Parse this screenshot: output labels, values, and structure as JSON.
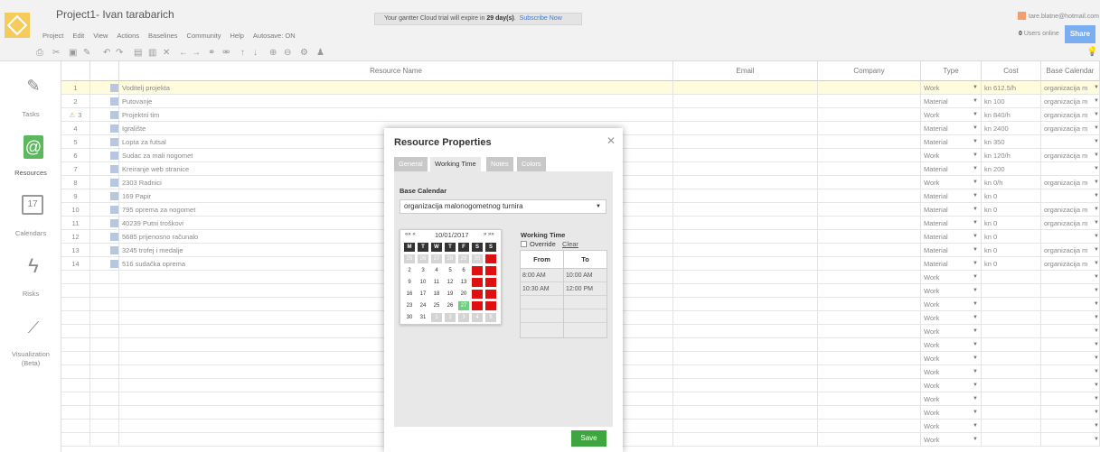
{
  "header": {
    "project_title": "Project1- Ivan tarabarich",
    "menu": [
      "Project",
      "Edit",
      "View",
      "Actions",
      "Baselines",
      "Community",
      "Help",
      "Autosave: ON"
    ],
    "trial_prefix": "Your gantter Cloud trial will expire in ",
    "trial_days": "29 day(s)",
    "trial_dot": ".",
    "subscribe": "Subscribe Now",
    "user_email": "tare.blatne@hotmail.com",
    "users_online_count": "0",
    "users_online_label": "Users online",
    "share": "Share"
  },
  "toolbar": {
    "icons": [
      "print-icon",
      "cut-icon",
      "copy-icon",
      "paste-icon",
      "undo-icon",
      "redo-icon",
      "insert-row-icon",
      "insert-column-icon",
      "delete-icon",
      "outdent-icon",
      "indent-icon",
      "link-icon",
      "unlink-icon",
      "move-up-icon",
      "move-down-icon",
      "zoom-in-icon",
      "zoom-out-icon",
      "settings-icon",
      "resource-icon",
      "lightbulb-icon"
    ]
  },
  "sidebar": {
    "items": [
      {
        "label": "Tasks",
        "icon": "edit-icon"
      },
      {
        "label": "Resources",
        "icon": "address-book-icon"
      },
      {
        "label": "Calendars",
        "icon": "calendar-icon",
        "icon_text": "17"
      },
      {
        "label": "Risks",
        "icon": "lightning-icon"
      },
      {
        "label": "Visualization",
        "label2": "(Beta)",
        "icon": "chart-icon"
      }
    ]
  },
  "grid": {
    "columns": {
      "resource_name": "Resource Name",
      "email": "Email",
      "company": "Company",
      "type": "Type",
      "cost": "Cost",
      "base_calendar": "Base Calendar"
    },
    "rows": [
      {
        "num": "1",
        "name": "Voditelj projekta",
        "type": "Work",
        "cost": "kn 612.5/h",
        "calendar": "organizacija m"
      },
      {
        "num": "2",
        "name": "Putovanje",
        "type": "Material",
        "cost": "kn 100",
        "calendar": "organizacija m"
      },
      {
        "num": "3",
        "name": "Projektni tim",
        "type": "Work",
        "cost": "kn 840/h",
        "calendar": "organizacija m"
      },
      {
        "num": "4",
        "name": "Igralište",
        "type": "Material",
        "cost": "kn 2400",
        "calendar": "organizacija m"
      },
      {
        "num": "5",
        "name": "Lopta za futsal",
        "type": "Material",
        "cost": "kn 350",
        "calendar": ""
      },
      {
        "num": "6",
        "name": "Sudac za mali nogomet",
        "type": "Work",
        "cost": "kn 120/h",
        "calendar": "organizacija m"
      },
      {
        "num": "7",
        "name": "Kreiranje web stranice",
        "type": "Material",
        "cost": "kn 200",
        "calendar": ""
      },
      {
        "num": "8",
        "name": "2303 Radnici",
        "type": "Work",
        "cost": "kn 0/h",
        "calendar": "organizacija m"
      },
      {
        "num": "9",
        "name": "169 Papir",
        "type": "Material",
        "cost": "kn 0",
        "calendar": ""
      },
      {
        "num": "10",
        "name": "795 oprema za nogomet",
        "type": "Material",
        "cost": "kn 0",
        "calendar": "organizacija m"
      },
      {
        "num": "11",
        "name": "40239 Putni troškovi",
        "type": "Material",
        "cost": "kn 0",
        "calendar": "organizacija m"
      },
      {
        "num": "12",
        "name": "5685 prijenosno računalo",
        "type": "Material",
        "cost": "kn 0",
        "calendar": ""
      },
      {
        "num": "13",
        "name": "3245 trofej i medalje",
        "type": "Material",
        "cost": "kn 0",
        "calendar": "organizacija m"
      },
      {
        "num": "14",
        "name": "516 sudačka oprema",
        "type": "Material",
        "cost": "kn 0",
        "calendar": "organizacija m"
      }
    ],
    "empty_type": "Work"
  },
  "modal": {
    "title": "Resource Properties",
    "tabs": [
      "General",
      "Working Time",
      "Notes",
      "Colors"
    ],
    "active_tab": "Working Time",
    "base_calendar_label": "Base Calendar",
    "base_calendar_value": "organizacija malonogometnog turnira",
    "calendar": {
      "nav_prev": "«« «",
      "month": "10/01/2017",
      "nav_next": "» »»",
      "weekdays": [
        "M",
        "T",
        "W",
        "T",
        "F",
        "S",
        "S"
      ],
      "weeks": [
        [
          "25",
          "26",
          "27",
          "28",
          "29",
          "30",
          "1"
        ],
        [
          "2",
          "3",
          "4",
          "5",
          "6",
          "7",
          "8"
        ],
        [
          "9",
          "10",
          "11",
          "12",
          "13",
          "14",
          "15"
        ],
        [
          "16",
          "17",
          "18",
          "19",
          "20",
          "21",
          "22"
        ],
        [
          "23",
          "24",
          "25",
          "26",
          "27",
          "28",
          "29"
        ],
        [
          "30",
          "31",
          "1",
          "2",
          "3",
          "4",
          "5"
        ]
      ]
    },
    "working_time_label": "Working Time",
    "override_label": "Override",
    "clear_label": "Clear",
    "table_headers": [
      "From",
      "To"
    ],
    "time_rows": [
      {
        "from": "8:00 AM",
        "to": "10:00 AM"
      },
      {
        "from": "10:30 AM",
        "to": "12:00 PM"
      }
    ],
    "save": "Save"
  }
}
